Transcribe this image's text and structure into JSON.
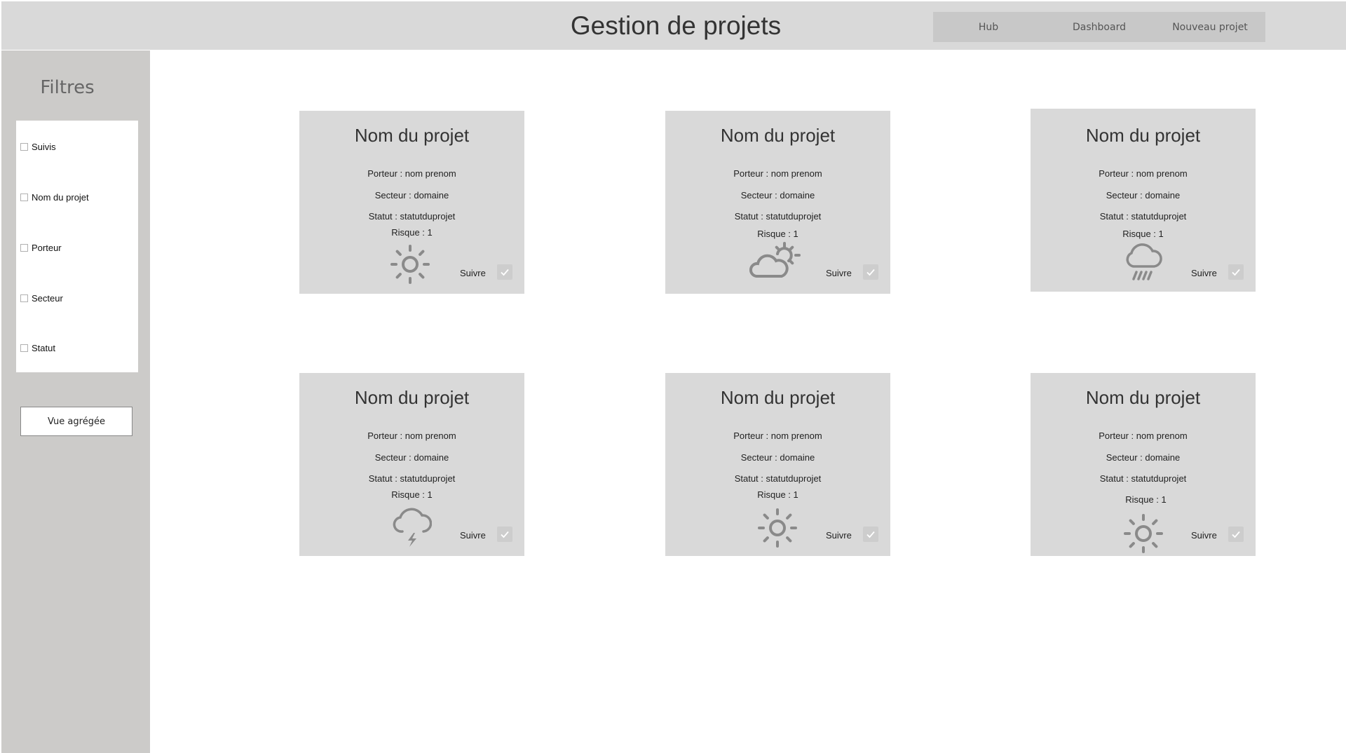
{
  "header": {
    "title": "Gestion de projets",
    "nav": [
      "Hub",
      "Dashboard",
      "Nouveau projet"
    ]
  },
  "sidebar": {
    "title": "Filtres",
    "filters": [
      "Suivis",
      "Nom du projet",
      "Porteur",
      "Secteur",
      "Statut"
    ],
    "aggregate_button": "Vue agrégée"
  },
  "cards": [
    {
      "title": "Nom du projet",
      "porteur": "Porteur : nom prenom",
      "secteur": "Secteur : domaine",
      "statut": "Statut : statutduprojet",
      "risque": "Risque : 1",
      "weather": "sun-icon",
      "follow": "Suivre",
      "checked": true
    },
    {
      "title": "Nom du projet",
      "porteur": "Porteur : nom prenom",
      "secteur": "Secteur : domaine",
      "statut": "Statut : statutduprojet",
      "risque": "Risque : 1",
      "weather": "partly-cloudy-icon",
      "follow": "Suivre",
      "checked": true
    },
    {
      "title": "Nom du projet",
      "porteur": "Porteur : nom prenom",
      "secteur": "Secteur : domaine",
      "statut": "Statut : statutduprojet",
      "risque": "Risque : 1",
      "weather": "rain-icon",
      "follow": "Suivre",
      "checked": true
    },
    {
      "title": "Nom du projet",
      "porteur": "Porteur : nom prenom",
      "secteur": "Secteur : domaine",
      "statut": "Statut : statutduprojet",
      "risque": "Risque : 1",
      "weather": "thunderstorm-icon",
      "follow": "Suivre",
      "checked": true
    },
    {
      "title": "Nom du projet",
      "porteur": "Porteur : nom prenom",
      "secteur": "Secteur : domaine",
      "statut": "Statut : statutduprojet",
      "risque": "Risque : 1",
      "weather": "sun-icon",
      "follow": "Suivre",
      "checked": true
    },
    {
      "title": "Nom du projet",
      "porteur": "Porteur : nom prenom",
      "secteur": "Secteur : domaine",
      "statut": "Statut : statutduprojet",
      "risque": "Risque : 1",
      "weather": "sun-icon",
      "follow": "Suivre",
      "checked": true
    }
  ],
  "colors": {
    "header_bg": "#d9d9d9",
    "sidebar_bg": "#cccbc9",
    "card_bg": "#d9d9d9",
    "icon": "#8a8a8a"
  }
}
